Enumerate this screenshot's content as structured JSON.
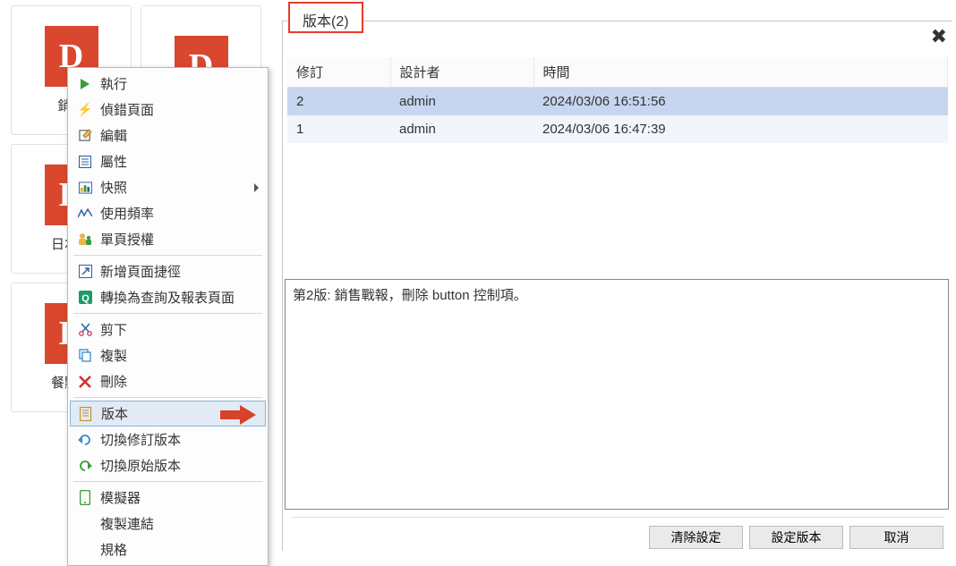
{
  "tiles": [
    {
      "label": "銷售"
    },
    {
      "label": ""
    },
    {
      "label": "日本銷"
    },
    {
      "label": ""
    },
    {
      "label": "餐點銷"
    },
    {
      "label": ""
    }
  ],
  "context_menu": {
    "items": [
      {
        "icon": "play",
        "label": "執行"
      },
      {
        "icon": "lightning",
        "label": "偵錯頁面"
      },
      {
        "icon": "edit",
        "label": "編輯"
      },
      {
        "icon": "list",
        "label": "屬性"
      },
      {
        "icon": "snapshot",
        "label": "快照",
        "has_submenu": true
      },
      {
        "icon": "chart",
        "label": "使用頻率"
      },
      {
        "icon": "permission",
        "label": "單頁授權"
      },
      {
        "icon": "shortcut",
        "label": "新增頁面捷徑"
      },
      {
        "icon": "convert",
        "label": "轉換為查詢及報表頁面"
      },
      {
        "icon": "cut",
        "label": "剪下"
      },
      {
        "icon": "copy",
        "label": "複製"
      },
      {
        "icon": "delete",
        "label": "刪除"
      },
      {
        "icon": "version",
        "label": "版本",
        "highlighted": true
      },
      {
        "icon": "back",
        "label": "切換修訂版本"
      },
      {
        "icon": "forward",
        "label": "切換原始版本"
      },
      {
        "icon": "simulator",
        "label": "模擬器"
      },
      {
        "icon": "",
        "label": "複製連結"
      },
      {
        "icon": "",
        "label": "規格"
      }
    ]
  },
  "dialog": {
    "tab_label": "版本(2)",
    "columns": {
      "revision": "修訂",
      "designer": "設計者",
      "time": "時間"
    },
    "rows": [
      {
        "revision": "2",
        "designer": "admin",
        "time": "2024/03/06 16:51:56",
        "selected": true
      },
      {
        "revision": "1",
        "designer": "admin",
        "time": "2024/03/06 16:47:39",
        "selected": false
      }
    ],
    "description": "第2版: 銷售戰報，刪除 button 控制項。",
    "buttons": {
      "clear": "清除設定",
      "set": "設定版本",
      "cancel": "取消"
    }
  }
}
